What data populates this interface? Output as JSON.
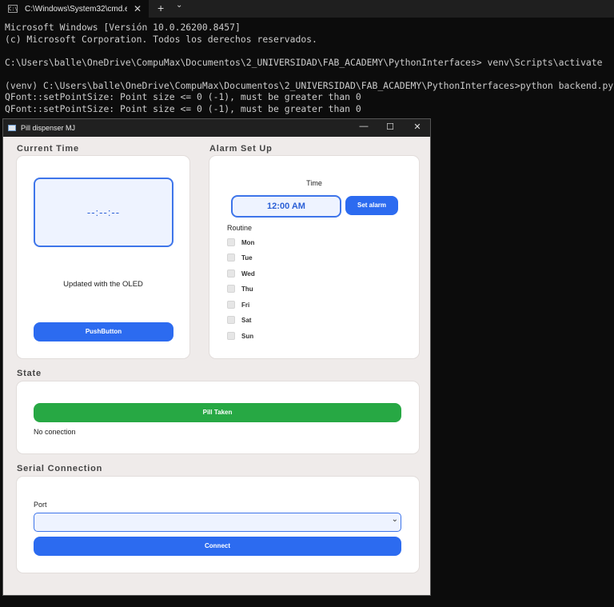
{
  "terminal": {
    "tab_title": "C:\\Windows\\System32\\cmd.e",
    "lines": [
      "Microsoft Windows [Versión 10.0.26200.8457]",
      "(c) Microsoft Corporation. Todos los derechos reservados.",
      "",
      "C:\\Users\\balle\\OneDrive\\CompuMax\\Documentos\\2_UNIVERSIDAD\\FAB_ACADEMY\\PythonInterfaces> venv\\Scripts\\activate",
      "",
      "(venv) C:\\Users\\balle\\OneDrive\\CompuMax\\Documentos\\2_UNIVERSIDAD\\FAB_ACADEMY\\PythonInterfaces>python backend.py",
      "QFont::setPointSize: Point size <= 0 (-1), must be greater than 0",
      "QFont::setPointSize: Point size <= 0 (-1), must be greater than 0"
    ]
  },
  "window": {
    "title": "Pill dispenser MJ",
    "current_time": {
      "group_title": "Current Time",
      "clock": "--:--:--",
      "caption": "Updated with the OLED",
      "button": "PushButton"
    },
    "alarm": {
      "group_title": "Alarm Set Up",
      "time_label": "Time",
      "time_value": "12:00 AM",
      "set_button": "Set alarm",
      "routine_label": "Routine",
      "days": [
        "Mon",
        "Tue",
        "Wed",
        "Thu",
        "Fri",
        "Sat",
        "Sun"
      ]
    },
    "state": {
      "group_title": "State",
      "button": "Pill Taken",
      "status": "No conection"
    },
    "serial": {
      "group_title": "Serial Connection",
      "port_label": "Port",
      "port_value": "",
      "button": "Connect"
    }
  },
  "colors": {
    "accent": "#2c6bf0",
    "success": "#27a844",
    "window_bg": "#efebea",
    "terminal_bg": "#0c0c0c"
  }
}
